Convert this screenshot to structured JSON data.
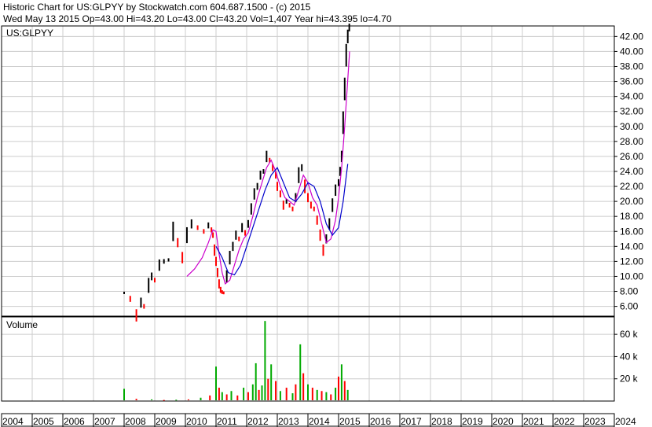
{
  "header": {
    "line1": "Historic Chart for US:GLPYY by Stockwatch.com 604.687.1500 - (c) 2015",
    "line2": "Wed May 13 2015   Op=43.00   Hi=43.20   Lo=43.00   Cl=43.20   Vol=1,407   Year hi=43.395   lo=4.70"
  },
  "colors": {
    "grid": "#cccccc",
    "price_bar": "#000000",
    "price_bar_down": "#ff0000",
    "ma_short": "#cc00cc",
    "ma_long": "#0000cc",
    "vol_up": "#00aa00",
    "vol_down": "#ff0000"
  },
  "chart_data": [
    {
      "type": "line",
      "title": "US:GLPYY",
      "ylim": [
        4.7,
        43.4
      ],
      "y_ticks": [
        6,
        8,
        10,
        12,
        14,
        16,
        18,
        20,
        22,
        24,
        26,
        28,
        30,
        32,
        34,
        36,
        38,
        40,
        42
      ],
      "y_tick_labels": [
        "6.00",
        "8.00",
        "10.00",
        "12.00",
        "14.00",
        "16.00",
        "18.00",
        "20.00",
        "22.00",
        "24.00",
        "26.00",
        "28.00",
        "30.00",
        "32.00",
        "34.00",
        "36.00",
        "38.00",
        "40.00",
        "42.00"
      ],
      "xlim": [
        2004.0,
        2024.0
      ],
      "x_tick_labels": [
        "2004",
        "2005",
        "2006",
        "2007",
        "2008",
        "2009",
        "2010",
        "2011",
        "2012",
        "2013",
        "2014",
        "2015",
        "2016",
        "2017",
        "2018",
        "2019",
        "2020",
        "2021",
        "2022",
        "2023",
        "2024"
      ],
      "grid": true,
      "series": [
        {
          "style": "price",
          "x": [
            2008.0,
            2008.2,
            2008.4,
            2008.55,
            2008.65,
            2008.8,
            2008.9,
            2009.0,
            2009.15,
            2009.3,
            2009.45,
            2009.6,
            2009.75,
            2009.9,
            2010.05,
            2010.2,
            2010.4,
            2010.6,
            2010.75,
            2010.85,
            2010.9,
            2010.95,
            2011.0,
            2011.05,
            2011.1,
            2011.15,
            2011.2,
            2011.25,
            2011.35,
            2011.45,
            2011.55,
            2011.65,
            2011.75,
            2011.85,
            2011.95,
            2012.05,
            2012.15,
            2012.25,
            2012.35,
            2012.45,
            2012.55,
            2012.65,
            2012.75,
            2012.85,
            2012.95,
            2013.0,
            2013.1,
            2013.2,
            2013.3,
            2013.4,
            2013.5,
            2013.6,
            2013.7,
            2013.8,
            2013.9,
            2014.0,
            2014.1,
            2014.2,
            2014.3,
            2014.4,
            2014.5,
            2014.6,
            2014.7,
            2014.8,
            2014.9,
            2015.0,
            2015.05,
            2015.1,
            2015.15,
            2015.2,
            2015.25,
            2015.3,
            2015.35
          ],
          "y": [
            7.8,
            7.0,
            4.8,
            6.5,
            6.0,
            8.8,
            10.0,
            9.5,
            11.5,
            12.0,
            12.2,
            16.0,
            14.5,
            12.5,
            15.5,
            17.0,
            16.5,
            16.0,
            16.8,
            16.2,
            15.5,
            13.5,
            12.0,
            10.5,
            9.0,
            8.2,
            7.9,
            7.8,
            10.0,
            12.5,
            14.0,
            15.5,
            15.0,
            16.5,
            15.8,
            17.0,
            19.0,
            21.0,
            22.0,
            23.5,
            24.0,
            26.0,
            25.5,
            24.5,
            23.5,
            22.0,
            21.0,
            19.5,
            20.0,
            19.5,
            19.0,
            20.5,
            23.5,
            24.5,
            22.0,
            20.5,
            19.5,
            19.0,
            17.5,
            15.5,
            13.5,
            15.0,
            17.0,
            19.5,
            21.5,
            22.5,
            24.0,
            26.0,
            30.5,
            35.0,
            39.5,
            42.0,
            43.2
          ]
        },
        {
          "style": "ma_short",
          "x": [
            2010.05,
            2010.3,
            2010.55,
            2010.75,
            2010.9,
            2011.0,
            2011.1,
            2011.2,
            2011.3,
            2011.45,
            2011.6,
            2011.75,
            2011.9,
            2012.05,
            2012.2,
            2012.35,
            2012.5,
            2012.65,
            2012.8,
            2012.95,
            2013.1,
            2013.25,
            2013.4,
            2013.55,
            2013.7,
            2013.85,
            2014.0,
            2014.15,
            2014.3,
            2014.45,
            2014.6,
            2014.75,
            2014.9,
            2015.0,
            2015.1,
            2015.2,
            2015.28,
            2015.36
          ],
          "y": [
            10.0,
            11.0,
            12.5,
            14.5,
            16.2,
            16.0,
            13.0,
            10.5,
            9.0,
            9.5,
            11.5,
            13.5,
            15.0,
            15.8,
            18.0,
            20.5,
            22.5,
            24.5,
            25.5,
            24.0,
            22.0,
            20.5,
            20.0,
            19.5,
            21.5,
            23.5,
            22.5,
            20.5,
            19.5,
            17.0,
            14.5,
            15.0,
            17.5,
            20.5,
            24.5,
            30.0,
            35.0,
            40.0
          ]
        },
        {
          "style": "ma_long",
          "x": [
            2011.0,
            2011.2,
            2011.4,
            2011.6,
            2011.8,
            2012.0,
            2012.2,
            2012.4,
            2012.6,
            2012.8,
            2013.0,
            2013.2,
            2013.4,
            2013.6,
            2013.8,
            2014.0,
            2014.2,
            2014.4,
            2014.6,
            2014.8,
            2015.0,
            2015.15,
            2015.3
          ],
          "y": [
            14.0,
            12.5,
            10.5,
            10.2,
            11.5,
            14.0,
            16.5,
            19.0,
            21.5,
            23.5,
            24.5,
            22.5,
            20.5,
            20.0,
            21.0,
            22.5,
            22.0,
            20.0,
            17.0,
            15.5,
            16.5,
            20.0,
            25.0
          ]
        }
      ]
    },
    {
      "type": "bar",
      "title": "Volume",
      "ylim": [
        0,
        70000
      ],
      "y_ticks": [
        20000,
        40000,
        60000
      ],
      "y_tick_labels": [
        "20 k",
        "40 k",
        "60 k"
      ],
      "xlim": [
        2004.0,
        2024.0
      ],
      "series": [
        {
          "name": "",
          "x": [
            2008.0,
            2008.4,
            2008.9,
            2009.3,
            2009.7,
            2010.1,
            2010.5,
            2010.8,
            2011.0,
            2011.1,
            2011.2,
            2011.35,
            2011.5,
            2011.7,
            2011.9,
            2012.05,
            2012.2,
            2012.3,
            2012.4,
            2012.5,
            2012.6,
            2012.7,
            2012.8,
            2012.95,
            2013.1,
            2013.3,
            2013.5,
            2013.6,
            2013.75,
            2013.85,
            2014.0,
            2014.15,
            2014.3,
            2014.45,
            2014.6,
            2014.75,
            2014.9,
            2015.0,
            2015.1,
            2015.2,
            2015.3
          ],
          "y": [
            11000,
            2000,
            1500,
            1000,
            1200,
            1500,
            3000,
            5000,
            31000,
            12000,
            8000,
            6000,
            9000,
            5000,
            12000,
            8000,
            15000,
            34000,
            10000,
            14000,
            72000,
            20000,
            33000,
            18000,
            9000,
            12000,
            7000,
            15000,
            51000,
            25000,
            15000,
            12000,
            10000,
            9000,
            8000,
            6000,
            12000,
            22000,
            33000,
            18000,
            10000
          ],
          "up": [
            true,
            false,
            true,
            false,
            true,
            false,
            true,
            false,
            true,
            false,
            true,
            false,
            true,
            false,
            true,
            false,
            true,
            true,
            false,
            true,
            true,
            false,
            true,
            false,
            true,
            false,
            true,
            false,
            true,
            false,
            true,
            false,
            true,
            false,
            true,
            false,
            true,
            false,
            true,
            false,
            true
          ]
        }
      ]
    }
  ]
}
